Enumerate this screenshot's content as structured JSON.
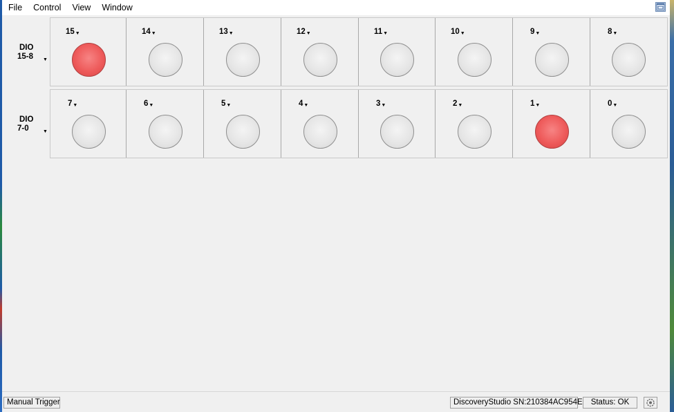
{
  "menubar": {
    "items": [
      "File",
      "Control",
      "View",
      "Window"
    ]
  },
  "rows": [
    {
      "label_line1": "DIO",
      "label_line2": "15-8",
      "bits": [
        {
          "label": "15",
          "on": true
        },
        {
          "label": "14",
          "on": false
        },
        {
          "label": "13",
          "on": false
        },
        {
          "label": "12",
          "on": false
        },
        {
          "label": "11",
          "on": false
        },
        {
          "label": "10",
          "on": false
        },
        {
          "label": "9",
          "on": false
        },
        {
          "label": "8",
          "on": false
        }
      ]
    },
    {
      "label_line1": "DIO",
      "label_line2": "7-0",
      "bits": [
        {
          "label": "7",
          "on": false
        },
        {
          "label": "6",
          "on": false
        },
        {
          "label": "5",
          "on": false
        },
        {
          "label": "4",
          "on": false
        },
        {
          "label": "3",
          "on": false
        },
        {
          "label": "2",
          "on": false
        },
        {
          "label": "1",
          "on": true
        },
        {
          "label": "0",
          "on": false
        }
      ]
    }
  ],
  "colors": {
    "led_on": "#ee5b5b",
    "led_off": "#e6e6e6"
  },
  "statusbar": {
    "trigger_label": "Manual Trigger",
    "device_label": "DiscoveryStudio SN:210384AC954E",
    "status_label": "Status: OK",
    "settings_icon": "gear-refresh-icon"
  }
}
